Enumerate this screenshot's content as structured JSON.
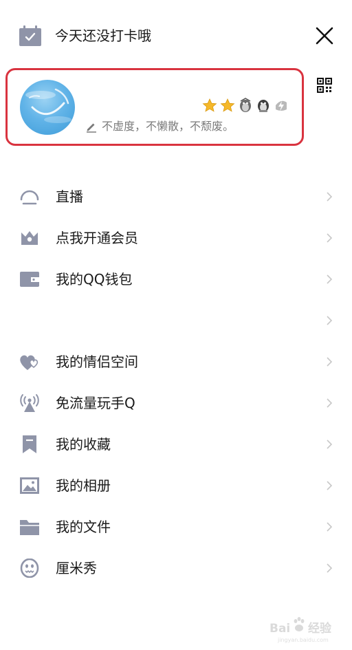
{
  "header": {
    "checkin_text": "今天还没打卡哦",
    "checkin_icon": "calendar-check-icon",
    "close_icon": "close-icon"
  },
  "profile": {
    "signature": "不虚度，不懒散，不颓废。",
    "badges": [
      "crown-star-icon",
      "crown-star-icon",
      "penguin-badge-icon",
      "penguin-badge-icon",
      "flash-badge-icon"
    ],
    "qr_icon": "qr-code-icon"
  },
  "menu": {
    "items": [
      {
        "label": "直播",
        "icon": "live-icon"
      },
      {
        "label": "点我开通会员",
        "icon": "vip-crown-icon"
      },
      {
        "label": "我的QQ钱包",
        "icon": "wallet-icon"
      },
      {
        "label": "",
        "icon": ""
      },
      {
        "label": "我的情侣空间",
        "icon": "hearts-icon"
      },
      {
        "label": "免流量玩手Q",
        "icon": "signal-tower-icon"
      },
      {
        "label": "我的收藏",
        "icon": "bookmark-icon"
      },
      {
        "label": "我的相册",
        "icon": "photo-icon"
      },
      {
        "label": "我的文件",
        "icon": "folder-icon"
      },
      {
        "label": "厘米秀",
        "icon": "face-icon"
      }
    ]
  },
  "colors": {
    "icon_gray": "#8f94a8",
    "highlight_red": "#d9333f",
    "chevron": "#c8c8c8"
  },
  "watermark": {
    "text": "Bai 经验",
    "url": "jingyan.baidu.com"
  }
}
